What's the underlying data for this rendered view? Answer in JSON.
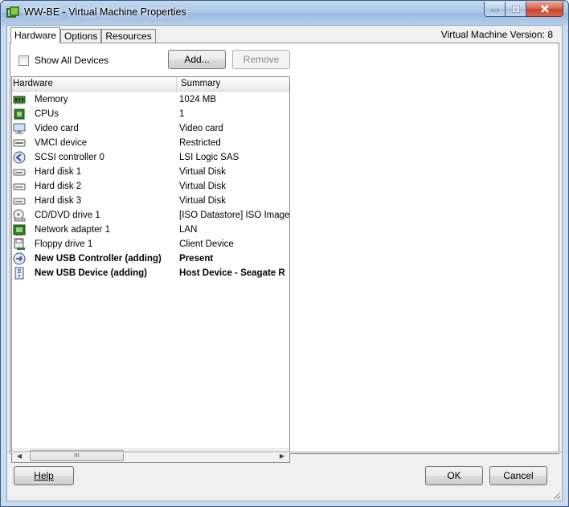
{
  "window": {
    "title": "WW-BE - Virtual Machine Properties",
    "minimize_icon": "minimize-icon",
    "maximize_icon": "maximize-icon",
    "close_icon": "close-icon",
    "app_icon": "vmware-icon"
  },
  "tabs": [
    {
      "label": "Hardware",
      "active": true
    },
    {
      "label": "Options",
      "active": false
    },
    {
      "label": "Resources",
      "active": false
    }
  ],
  "vm_version": "Virtual Machine Version: 8",
  "show_all_devices": {
    "label": "Show All Devices",
    "checked": false
  },
  "buttons": {
    "add": "Add...",
    "remove": "Remove",
    "help": "Help",
    "ok": "OK",
    "cancel": "Cancel"
  },
  "table": {
    "columns": [
      "Hardware",
      "Summary"
    ],
    "rows": [
      {
        "icon": "memory-icon",
        "name": "Memory",
        "summary": "1024 MB",
        "bold": false
      },
      {
        "icon": "cpu-icon",
        "name": "CPUs",
        "summary": "1",
        "bold": false
      },
      {
        "icon": "monitor-icon",
        "name": "Video card",
        "summary": "Video card",
        "bold": false
      },
      {
        "icon": "device-icon",
        "name": "VMCI device",
        "summary": "Restricted",
        "bold": false
      },
      {
        "icon": "scsi-controller-icon",
        "name": "SCSI controller 0",
        "summary": "LSI Logic SAS",
        "bold": false
      },
      {
        "icon": "hard-disk-icon",
        "name": "Hard disk 1",
        "summary": "Virtual Disk",
        "bold": false
      },
      {
        "icon": "hard-disk-icon",
        "name": "Hard disk 2",
        "summary": "Virtual Disk",
        "bold": false
      },
      {
        "icon": "hard-disk-icon",
        "name": "Hard disk 3",
        "summary": "Virtual Disk",
        "bold": false
      },
      {
        "icon": "cd-dvd-icon",
        "name": "CD/DVD drive 1",
        "summary": "[ISO Datastore] ISO Image",
        "bold": false
      },
      {
        "icon": "network-adapter-icon",
        "name": "Network adapter 1",
        "summary": "LAN",
        "bold": false
      },
      {
        "icon": "floppy-drive-icon",
        "name": "Floppy drive 1",
        "summary": "Client Device",
        "bold": false
      },
      {
        "icon": "usb-controller-icon",
        "name": "New USB Controller (adding)",
        "summary": "Present",
        "bold": true
      },
      {
        "icon": "usb-device-icon",
        "name": "New USB Device (adding)",
        "summary": "Host Device - Seagate R",
        "bold": true
      }
    ]
  },
  "scrollbar": {
    "left_icon": "scroll-left-icon",
    "right_icon": "scroll-right-icon",
    "thumb_grip": "III"
  }
}
